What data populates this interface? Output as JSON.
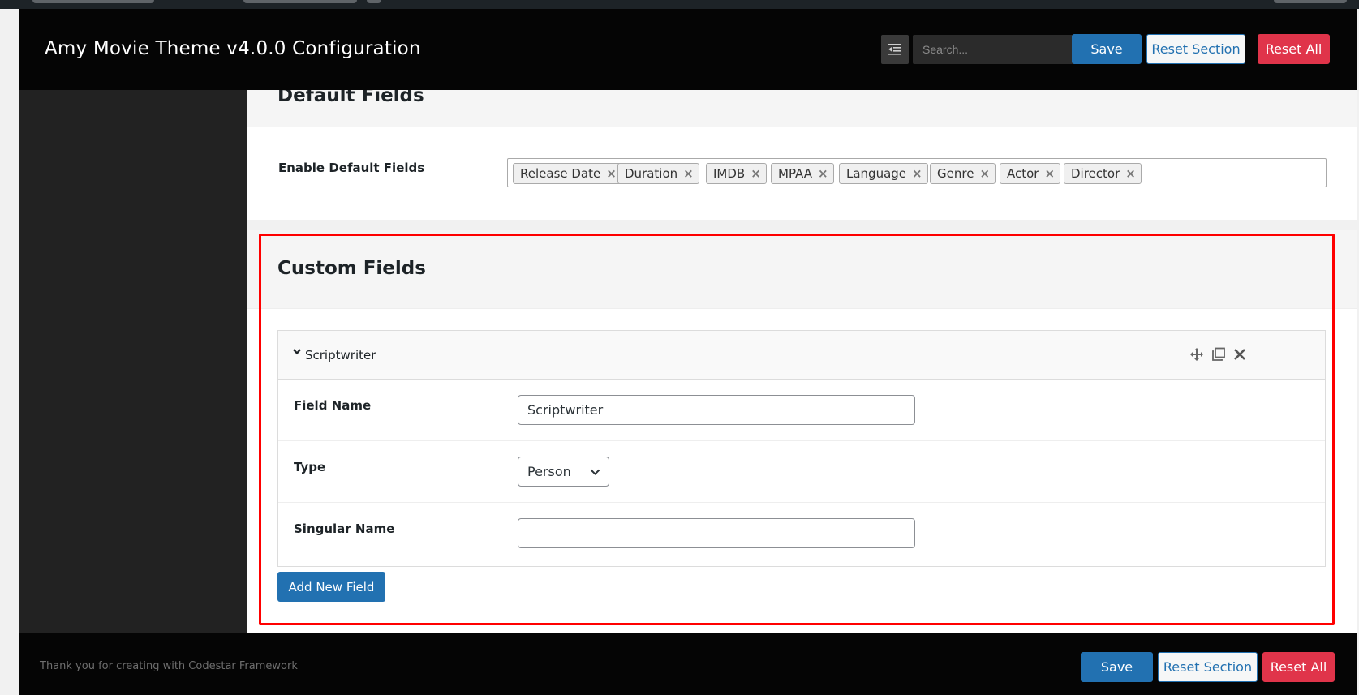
{
  "header": {
    "title": "Amy Movie Theme v4.0.0 Configuration",
    "search_placeholder": "Search...",
    "save_label": "Save",
    "reset_section_label": "Reset Section",
    "reset_all_label": "Reset All",
    "expand_icon": "expand-collapse-icon"
  },
  "default_fields": {
    "heading": "Default Fields",
    "field_label": "Enable Default Fields",
    "tags": [
      "Release Date",
      "Duration",
      "IMDB",
      "MPAA",
      "Language",
      "Genre",
      "Actor",
      "Director"
    ],
    "remove_glyph": "×"
  },
  "custom_fields": {
    "heading": "Custom Fields",
    "item": {
      "title": "Scriptwriter",
      "tools": [
        "move-icon",
        "clone-icon",
        "remove-icon"
      ],
      "field_name_label": "Field Name",
      "field_name_value": "Scriptwriter",
      "type_label": "Type",
      "type_value": "Person",
      "singular_name_label": "Singular Name",
      "singular_name_value": ""
    },
    "add_button_label": "Add New Field"
  },
  "footer": {
    "text": "Thank you for creating with Codestar Framework",
    "save_label": "Save",
    "reset_section_label": "Reset Section",
    "reset_all_label": "Reset All"
  },
  "colors": {
    "header_bg": "#050505",
    "sidebar_bg": "#222222",
    "primary": "#2271b1",
    "danger": "#e0344a",
    "highlight": "#ff0000"
  }
}
